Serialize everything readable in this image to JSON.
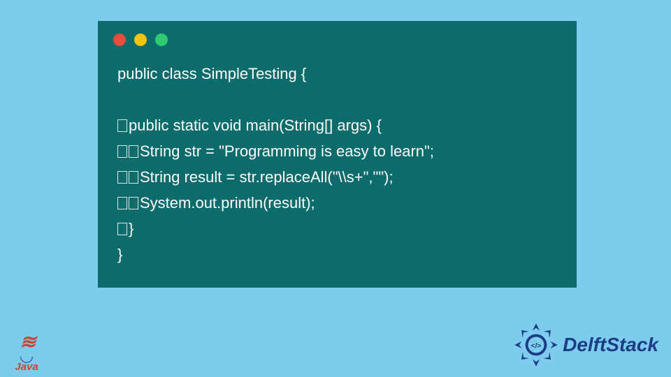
{
  "window": {
    "dots": [
      "red",
      "yellow",
      "green"
    ]
  },
  "code": {
    "lines": [
      {
        "indent": 0,
        "text": "public class SimpleTesting {"
      },
      {
        "indent": 0,
        "text": ""
      },
      {
        "indent": 1,
        "text": "public static void main(String[] args) {"
      },
      {
        "indent": 2,
        "text": "String str = \"Programming is easy to learn\";"
      },
      {
        "indent": 2,
        "text": "String result = str.replaceAll(\"\\\\s+\",\"\");"
      },
      {
        "indent": 2,
        "text": "System.out.println(result);"
      },
      {
        "indent": 1,
        "text": "}"
      },
      {
        "indent": 0,
        "text": "}"
      }
    ]
  },
  "logos": {
    "java_label": "Java",
    "delft_label": "DelftStack"
  },
  "colors": {
    "page_bg": "#7ECCED",
    "window_bg": "#0C6B6B",
    "delft_blue": "#1C3C86",
    "java_orange": "#C74634"
  }
}
